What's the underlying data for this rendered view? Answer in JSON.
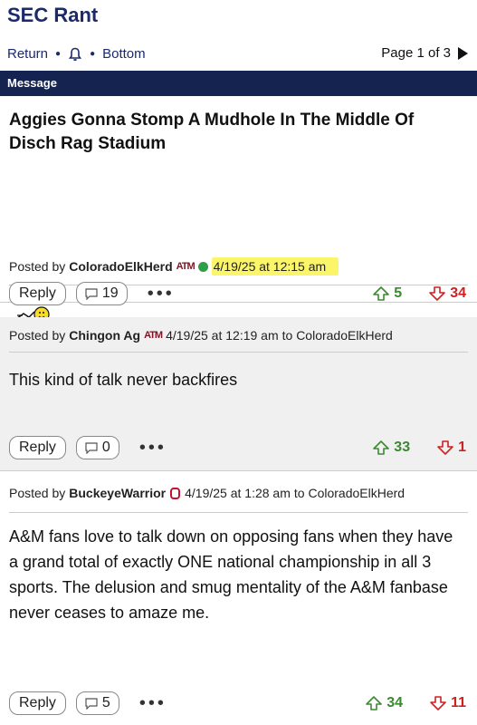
{
  "site": {
    "title": "SEC Rant"
  },
  "nav": {
    "return": "Return",
    "bottom": "Bottom",
    "page": "Page 1 of 3"
  },
  "message_bar": "Message",
  "op": {
    "title": "Aggies Gonna Stomp A Mudhole In The Middle Of Disch Rag Stadium",
    "posted_by": "Posted by",
    "username": "ColoradoElkHerd",
    "team_logo": "ATM",
    "timestamp": "4/19/25 at 12:15 am",
    "reply_label": "Reply",
    "comment_count": "19",
    "upvotes": "5",
    "downvotes": "34"
  },
  "replies": [
    {
      "posted_by": "Posted by",
      "username": "Chingon Ag",
      "team_logo": "ATM",
      "timestamp": "4/19/25 at 12:19 am",
      "to": "to ColoradoElkHerd",
      "body": "This kind of talk never backfires",
      "reply_label": "Reply",
      "comment_count": "0",
      "upvotes": "33",
      "downvotes": "1"
    },
    {
      "posted_by": "Posted by",
      "username": "BuckeyeWarrior",
      "timestamp": "4/19/25 at 1:28 am",
      "to": "to ColoradoElkHerd",
      "body": "A&M fans love to talk down on opposing fans when they have a grand total of exactly ONE national championship in all 3 sports. The delusion and smug mentality of the A&M fanbase never ceases to amaze me.",
      "reply_label": "Reply",
      "comment_count": "5",
      "upvotes": "34",
      "downvotes": "11"
    }
  ],
  "colors": {
    "navy": "#14234f",
    "title_blue": "#1a2a6b",
    "upvote": "#3a8a2f",
    "downvote": "#d02020",
    "highlight": "#fbf56a"
  },
  "icons": [
    "bell-icon",
    "next-page-icon",
    "online-status-icon",
    "smiley-icon",
    "comment-icon",
    "upvote-icon",
    "downvote-icon",
    "more-options-icon"
  ]
}
